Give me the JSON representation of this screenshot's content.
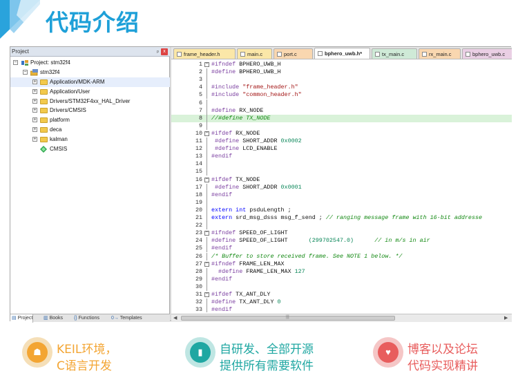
{
  "banner": {
    "title": "代码介绍",
    "accent": "#1ea0d8"
  },
  "project_pane": {
    "header_label": "Project",
    "pin_glyph": "ᵖ",
    "close_glyph": "x",
    "tree": [
      {
        "label": "Project: stm32f4",
        "icon": "project-icon",
        "expander": "−"
      },
      {
        "label": "stm32f4",
        "icon": "target-icon",
        "expander": "−"
      },
      {
        "label": "Application/MDK-ARM",
        "icon": "folder-icon",
        "expander": "+"
      },
      {
        "label": "Application/User",
        "icon": "folder-icon",
        "expander": "+"
      },
      {
        "label": "Drivers/STM32F4xx_HAL_Driver",
        "icon": "folder-icon",
        "expander": "+"
      },
      {
        "label": "Drivers/CMSIS",
        "icon": "folder-icon",
        "expander": "+"
      },
      {
        "label": "platform",
        "icon": "folder-icon",
        "expander": "+"
      },
      {
        "label": "deca",
        "icon": "folder-icon",
        "expander": "+"
      },
      {
        "label": "kalman",
        "icon": "folder-icon",
        "expander": "+"
      },
      {
        "label": "CMSIS",
        "icon": "cmsis-gem-icon",
        "expander": ""
      }
    ],
    "tabs": [
      "Project",
      "Books",
      "Functions",
      "Templates"
    ],
    "tab_glyphs": [
      "▤",
      "▥",
      "{}",
      "0→"
    ]
  },
  "editor": {
    "tabs": [
      {
        "label": "frame_header.h",
        "color": "#fbe7a8"
      },
      {
        "label": "main.c",
        "color": "#fbe7a8"
      },
      {
        "label": "port.c",
        "color": "#f9d7b0"
      },
      {
        "label": "bphero_uwb.h*",
        "color": "#ffffff"
      },
      {
        "label": "tx_main.c",
        "color": "#cfead7"
      },
      {
        "label": "rx_main.c",
        "color": "#f9d7b0"
      },
      {
        "label": "bphero_uwb.c",
        "color": "#eacfe4"
      }
    ],
    "lines": [
      {
        "n": "1",
        "fold": "−",
        "parts": [
          [
            "k-pre",
            "#ifndef"
          ],
          [
            "k-id",
            " BPHERO_UWB_H"
          ]
        ]
      },
      {
        "n": "2",
        "fold": "",
        "parts": [
          [
            "k-pre",
            "#define"
          ],
          [
            "k-id",
            " BPHERO_UWB_H"
          ]
        ]
      },
      {
        "n": "3",
        "fold": "",
        "parts": []
      },
      {
        "n": "4",
        "fold": "",
        "parts": [
          [
            "k-pre",
            "#include"
          ],
          [
            "k-str",
            " \"frame_header.h\""
          ]
        ]
      },
      {
        "n": "5",
        "fold": "",
        "parts": [
          [
            "k-pre",
            "#include"
          ],
          [
            "k-str",
            " \"common_header.h\""
          ]
        ]
      },
      {
        "n": "6",
        "fold": "",
        "parts": []
      },
      {
        "n": "7",
        "fold": "",
        "parts": [
          [
            "k-pre",
            "#define"
          ],
          [
            "k-id",
            " RX_NODE"
          ]
        ]
      },
      {
        "n": "8",
        "fold": "",
        "hl": true,
        "parts": [
          [
            "k-cm",
            "//#define TX_NODE"
          ]
        ]
      },
      {
        "n": "9",
        "fold": "",
        "parts": []
      },
      {
        "n": "10",
        "fold": "−",
        "parts": [
          [
            "k-pre",
            "#ifdef"
          ],
          [
            "k-id",
            " RX_NODE"
          ]
        ]
      },
      {
        "n": "11",
        "fold": "",
        "parts": [
          [
            "k-pre",
            " #define"
          ],
          [
            "k-id",
            " SHORT_ADDR "
          ],
          [
            "k-num",
            "0x0002"
          ]
        ]
      },
      {
        "n": "12",
        "fold": "",
        "parts": [
          [
            "k-pre",
            " #define"
          ],
          [
            "k-id",
            " LCD_ENABLE"
          ]
        ]
      },
      {
        "n": "13",
        "fold": "",
        "parts": [
          [
            "k-pre",
            "#endif"
          ]
        ]
      },
      {
        "n": "14",
        "fold": "",
        "parts": []
      },
      {
        "n": "15",
        "fold": "",
        "parts": []
      },
      {
        "n": "16",
        "fold": "−",
        "parts": [
          [
            "k-pre",
            "#ifdef"
          ],
          [
            "k-id",
            " TX_NODE"
          ]
        ]
      },
      {
        "n": "17",
        "fold": "",
        "parts": [
          [
            "k-pre",
            " #define"
          ],
          [
            "k-id",
            " SHORT_ADDR "
          ],
          [
            "k-num",
            "0x0001"
          ]
        ]
      },
      {
        "n": "18",
        "fold": "",
        "parts": [
          [
            "k-pre",
            "#endif"
          ]
        ]
      },
      {
        "n": "19",
        "fold": "",
        "parts": []
      },
      {
        "n": "20",
        "fold": "",
        "parts": [
          [
            "k-kw",
            "extern"
          ],
          [
            "k-kw",
            " int"
          ],
          [
            "k-id",
            " psduLength ;"
          ]
        ]
      },
      {
        "n": "21",
        "fold": "",
        "parts": [
          [
            "k-kw",
            "extern"
          ],
          [
            "k-id",
            " srd_msg_dsss msg_f_send ; "
          ],
          [
            "k-cm",
            "// ranging message frame with 16-bit addresse"
          ]
        ]
      },
      {
        "n": "22",
        "fold": "",
        "parts": []
      },
      {
        "n": "23",
        "fold": "−",
        "parts": [
          [
            "k-pre",
            "#ifndef"
          ],
          [
            "k-id",
            " SPEED_OF_LIGHT"
          ]
        ]
      },
      {
        "n": "24",
        "fold": "",
        "parts": [
          [
            "k-pre",
            "#define"
          ],
          [
            "k-id",
            " SPEED_OF_LIGHT      "
          ],
          [
            "k-num",
            "(299702547.0)"
          ],
          [
            "k-cm",
            "      // in m/s in air"
          ]
        ]
      },
      {
        "n": "25",
        "fold": "",
        "parts": [
          [
            "k-pre",
            "#endif"
          ]
        ]
      },
      {
        "n": "26",
        "fold": "",
        "parts": [
          [
            "k-cm",
            "/* Buffer to store received frame. See NOTE 1 below. */"
          ]
        ]
      },
      {
        "n": "27",
        "fold": "−",
        "parts": [
          [
            "k-pre",
            "#ifndef"
          ],
          [
            "k-id",
            " FRAME_LEN_MAX"
          ]
        ]
      },
      {
        "n": "28",
        "fold": "",
        "parts": [
          [
            "k-pre",
            "  #define"
          ],
          [
            "k-id",
            " FRAME_LEN_MAX "
          ],
          [
            "k-num",
            "127"
          ]
        ]
      },
      {
        "n": "29",
        "fold": "",
        "parts": [
          [
            "k-pre",
            "#endif"
          ]
        ]
      },
      {
        "n": "30",
        "fold": "",
        "parts": []
      },
      {
        "n": "31",
        "fold": "−",
        "parts": [
          [
            "k-pre",
            "#ifdef"
          ],
          [
            "k-id",
            " TX_ANT_DLY"
          ]
        ]
      },
      {
        "n": "32",
        "fold": "",
        "parts": [
          [
            "k-pre",
            "#define"
          ],
          [
            "k-id",
            " TX_ANT_DLY "
          ],
          [
            "k-num",
            "0"
          ]
        ]
      },
      {
        "n": "33",
        "fold": "",
        "parts": [
          [
            "k-pre",
            "#endif"
          ]
        ]
      }
    ]
  },
  "features": [
    {
      "line1": "KEIL环境，",
      "line2": "C语言开发",
      "icon": "person-icon",
      "glyph": "☗",
      "color": "#f3a533",
      "ring": "#f5dfb8"
    },
    {
      "line1": "自研发、全部开源",
      "line2": "提供所有需要软件",
      "icon": "bar-chart-icon",
      "glyph": "▮",
      "color": "#1fa7a2",
      "ring": "#bfe6e3"
    },
    {
      "line1": "博客以及论坛",
      "line2": "代码实现精讲",
      "icon": "thumbs-up-icon",
      "glyph": "♥",
      "color": "#e85d5d",
      "ring": "#f5c6c6"
    }
  ]
}
